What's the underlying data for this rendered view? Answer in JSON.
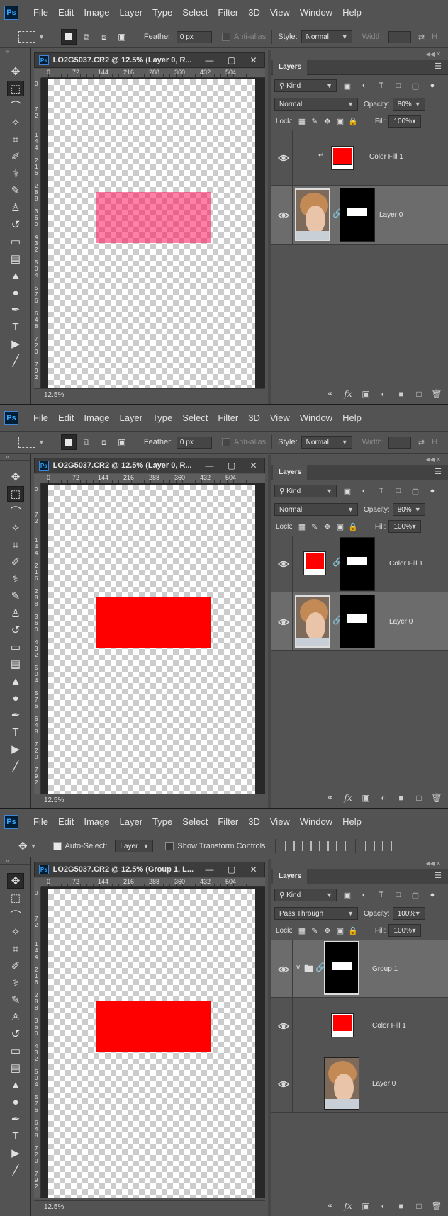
{
  "colors": {
    "ui_bg": "#535353",
    "fill_red": "#ff0000",
    "quickmask": "#ff0050",
    "selected_layer": "#6c6c6c"
  },
  "menu": [
    "File",
    "Edit",
    "Image",
    "Layer",
    "Type",
    "Select",
    "Filter",
    "3D",
    "View",
    "Window",
    "Help"
  ],
  "app_logo": "Ps",
  "panels": [
    {
      "options": {
        "feather_label": "Feather:",
        "feather_value": "0 px",
        "antialias_label": "Anti-alias",
        "style_label": "Style:",
        "style_value": "Normal",
        "width_label": "Width:",
        "h_label": "H"
      },
      "doc_title": "LO2G5037.CR2 @ 12.5% (Layer 0, R...",
      "zoom": "12.5%",
      "blend_mode": "Normal",
      "opacity_label": "Opacity:",
      "opacity": "80%",
      "lock_label": "Lock:",
      "fill_label": "Fill:",
      "fill": "100%",
      "layers": [
        {
          "name": "Color Fill 1"
        },
        {
          "name": "Layer 0"
        }
      ]
    },
    {
      "options": {
        "feather_label": "Feather:",
        "feather_value": "0 px",
        "antialias_label": "Anti-alias",
        "style_label": "Style:",
        "style_value": "Normal",
        "width_label": "Width:",
        "h_label": "H"
      },
      "doc_title": "LO2G5037.CR2 @ 12.5% (Layer 0, R...",
      "zoom": "12.5%",
      "blend_mode": "Normal",
      "opacity_label": "Opacity:",
      "opacity": "80%",
      "lock_label": "Lock:",
      "fill_label": "Fill:",
      "fill": "100%",
      "layers": [
        {
          "name": "Color Fill 1"
        },
        {
          "name": "Layer 0"
        }
      ]
    },
    {
      "options": {
        "autoselect_label": "Auto-Select:",
        "autoselect_target": "Layer",
        "show_transform_label": "Show Transform Controls"
      },
      "doc_title": "LO2G5037.CR2 @ 12.5% (Group 1, L...",
      "zoom": "12.5%",
      "blend_mode": "Pass Through",
      "opacity_label": "Opacity:",
      "opacity": "100%",
      "lock_label": "Lock:",
      "fill_label": "Fill:",
      "fill": "100%",
      "layers": [
        {
          "name": "Group 1"
        },
        {
          "name": "Color Fill 1"
        },
        {
          "name": "Layer 0"
        }
      ]
    }
  ],
  "layers_tab": "Layers",
  "filter_kind": "Kind",
  "ruler_h": [
    "0",
    "72",
    "144",
    "216",
    "288",
    "360",
    "432",
    "504"
  ],
  "ruler_v": [
    "0",
    "7 2",
    "1 4 4",
    "2 1 6",
    "2 8 8",
    "3 6 0",
    "4 3 2",
    "5 0 4",
    "5 7 6",
    "6 4 8",
    "7 2 0",
    "7 9 2"
  ],
  "icons": {
    "tools": [
      "move-tool-icon",
      "marquee-tool-icon",
      "lasso-tool-icon",
      "magic-wand-icon",
      "crop-tool-icon",
      "eyedropper-icon",
      "healing-brush-icon",
      "brush-tool-icon",
      "clone-stamp-icon",
      "history-brush-icon",
      "eraser-icon",
      "gradient-tool-icon",
      "blur-tool-icon",
      "dodge-tool-icon",
      "pen-tool-icon",
      "type-tool-icon",
      "path-selection-icon",
      "line-tool-icon"
    ],
    "footer": [
      "link-layers-icon",
      "fx-icon",
      "add-mask-icon",
      "adjustment-layer-icon",
      "new-group-icon",
      "new-layer-icon",
      "delete-layer-icon"
    ]
  }
}
